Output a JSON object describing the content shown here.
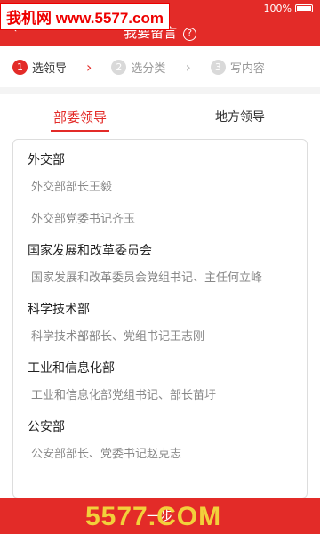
{
  "watermark": "我机网 www.5577.com",
  "status_bar": {
    "battery_text": "100%"
  },
  "header": {
    "back_glyph": "‹",
    "title": "我要留言",
    "help_glyph": "?"
  },
  "steps": [
    {
      "num": "1",
      "label": "选领导"
    },
    {
      "num": "2",
      "label": "选分类"
    },
    {
      "num": "3",
      "label": "写内容"
    }
  ],
  "tabs": [
    "部委领导",
    "地方领导"
  ],
  "departments": [
    {
      "name": "外交部",
      "leaders": [
        "外交部部长王毅",
        "外交部党委书记齐玉"
      ]
    },
    {
      "name": "国家发展和改革委员会",
      "leaders": [
        "国家发展和改革委员会党组书记、主任何立峰"
      ]
    },
    {
      "name": "科学技术部",
      "leaders": [
        "科学技术部部长、党组书记王志刚"
      ]
    },
    {
      "name": "工业和信息化部",
      "leaders": [
        "工业和信息化部党组书记、部长苗圩"
      ]
    },
    {
      "name": "公安部",
      "leaders": [
        "公安部部长、党委书记赵克志"
      ]
    }
  ],
  "bottom": {
    "label": "一步"
  },
  "logo_text": "5577.COM",
  "colors": {
    "accent": "#e32b28"
  }
}
